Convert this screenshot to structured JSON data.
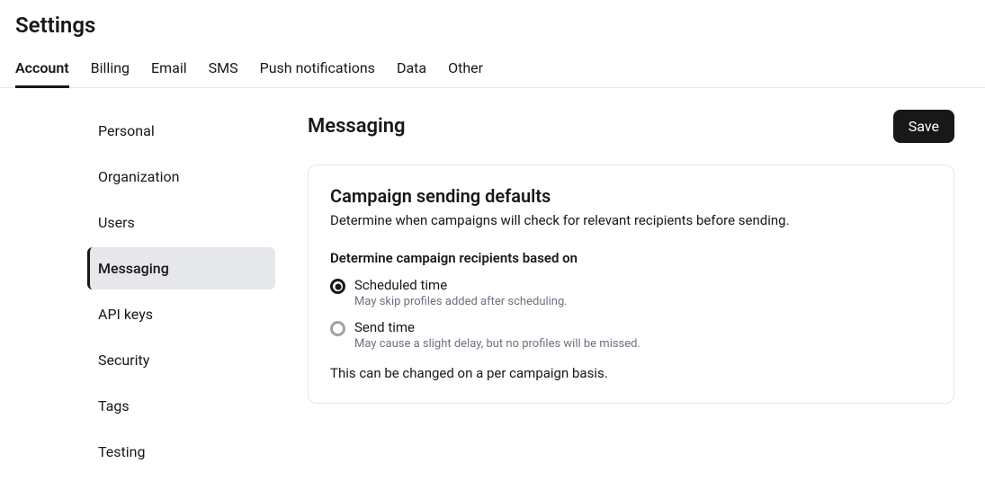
{
  "page": {
    "title": "Settings"
  },
  "tabs": {
    "account": "Account",
    "billing": "Billing",
    "email": "Email",
    "sms": "SMS",
    "push": "Push notifications",
    "data": "Data",
    "other": "Other"
  },
  "sidebar": {
    "personal": "Personal",
    "organization": "Organization",
    "users": "Users",
    "messaging": "Messaging",
    "api_keys": "API keys",
    "security": "Security",
    "tags": "Tags",
    "testing": "Testing"
  },
  "main": {
    "title": "Messaging",
    "save": "Save",
    "card": {
      "title": "Campaign sending defaults",
      "subtext": "Determine when campaigns will check for relevant recipients before sending.",
      "field_label": "Determine campaign recipients based on",
      "options": {
        "scheduled": {
          "label": "Scheduled time",
          "desc": "May skip profiles added after scheduling."
        },
        "send": {
          "label": "Send time",
          "desc": "May cause a slight delay, but no profiles will be missed."
        }
      },
      "note": "This can be changed on a per campaign basis."
    }
  }
}
